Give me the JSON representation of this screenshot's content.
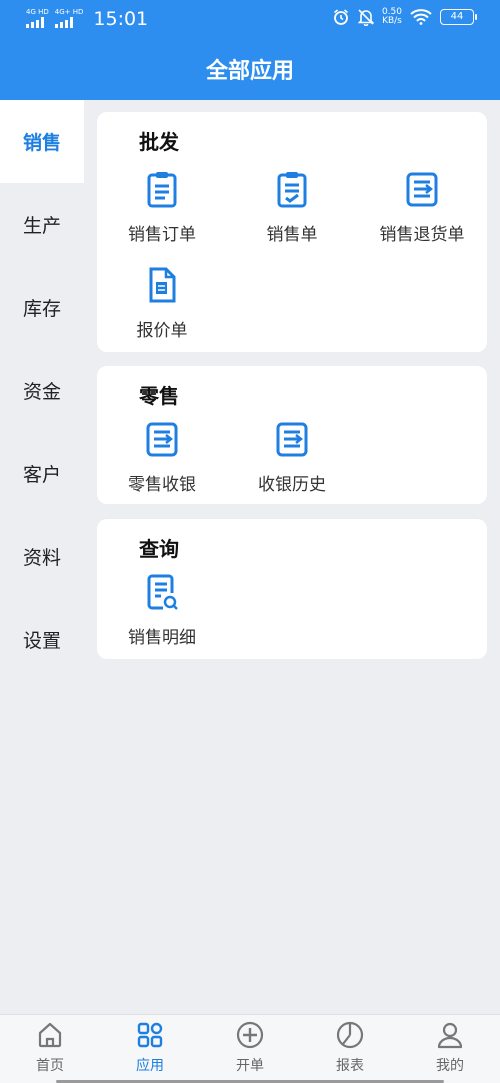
{
  "status_bar": {
    "network_1": "4G HD",
    "network_2": "4G+ HD",
    "time": "15:01",
    "speed_value": "0.50",
    "speed_unit": "KB/s",
    "battery": "44"
  },
  "header": {
    "title": "全部应用"
  },
  "sidebar": {
    "items": [
      {
        "label": "销售"
      },
      {
        "label": "生产"
      },
      {
        "label": "库存"
      },
      {
        "label": "资金"
      },
      {
        "label": "客户"
      },
      {
        "label": "资料"
      },
      {
        "label": "设置"
      }
    ]
  },
  "sections": [
    {
      "title": "批发",
      "items": [
        {
          "label": "销售订单",
          "icon": "clipboard-list-icon"
        },
        {
          "label": "销售单",
          "icon": "clipboard-check-icon"
        },
        {
          "label": "销售退货单",
          "icon": "document-arrow-icon"
        },
        {
          "label": "报价单",
          "icon": "quote-document-icon"
        }
      ]
    },
    {
      "title": "零售",
      "items": [
        {
          "label": "零售收银",
          "icon": "document-arrow-icon"
        },
        {
          "label": "收银历史",
          "icon": "document-arrow-icon"
        }
      ]
    },
    {
      "title": "查询",
      "items": [
        {
          "label": "销售明细",
          "icon": "document-search-icon"
        }
      ]
    }
  ],
  "bottom_nav": {
    "items": [
      {
        "label": "首页",
        "icon": "home-icon"
      },
      {
        "label": "应用",
        "icon": "apps-grid-icon"
      },
      {
        "label": "开单",
        "icon": "plus-circle-icon"
      },
      {
        "label": "报表",
        "icon": "pie-chart-icon"
      },
      {
        "label": "我的",
        "icon": "user-icon"
      }
    ]
  },
  "colors": {
    "brand": "#2d8ef0",
    "active_text": "#1e7fe0",
    "icon": "#1e7fe0",
    "page_bg": "#eceef2",
    "card_bg": "#ffffff"
  },
  "active_sidebar": "销售",
  "active_nav": "应用"
}
